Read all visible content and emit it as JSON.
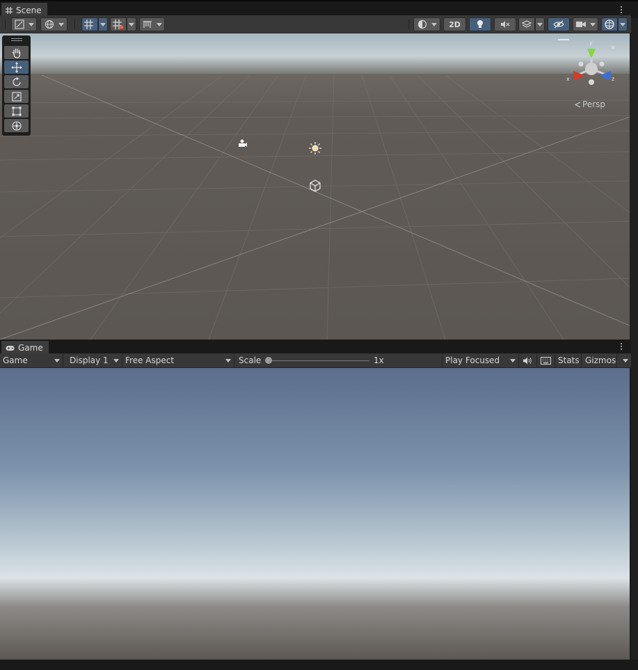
{
  "scene_tab": {
    "label": "Scene"
  },
  "scene_toolbar": {
    "button_2d": "2D",
    "persp_label": "Persp",
    "gizmo_axes": {
      "x": "x",
      "y": "y",
      "z": "z"
    }
  },
  "tools": [
    "hand-tool",
    "move-tool",
    "rotate-tool",
    "scale-tool",
    "rect-tool",
    "transform-tool"
  ],
  "game_tab": {
    "label": "Game"
  },
  "game_toolbar": {
    "mode_select": "Game",
    "display_select": "Display 1",
    "aspect_select": "Free Aspect",
    "scale_label": "Scale",
    "scale_value": "1x",
    "play_mode_select": "Play Focused",
    "stats_button": "Stats",
    "gizmos_button": "Gizmos"
  },
  "colors": {
    "accent": "#46607c",
    "panel": "#383838",
    "scene_ground": "#5e5955",
    "sky_top": "#5b708f",
    "horizon": "#dbe3e6",
    "gizmo_x": "#d23c2c",
    "gizmo_y": "#84d63b",
    "gizmo_z": "#3a6fd8"
  }
}
